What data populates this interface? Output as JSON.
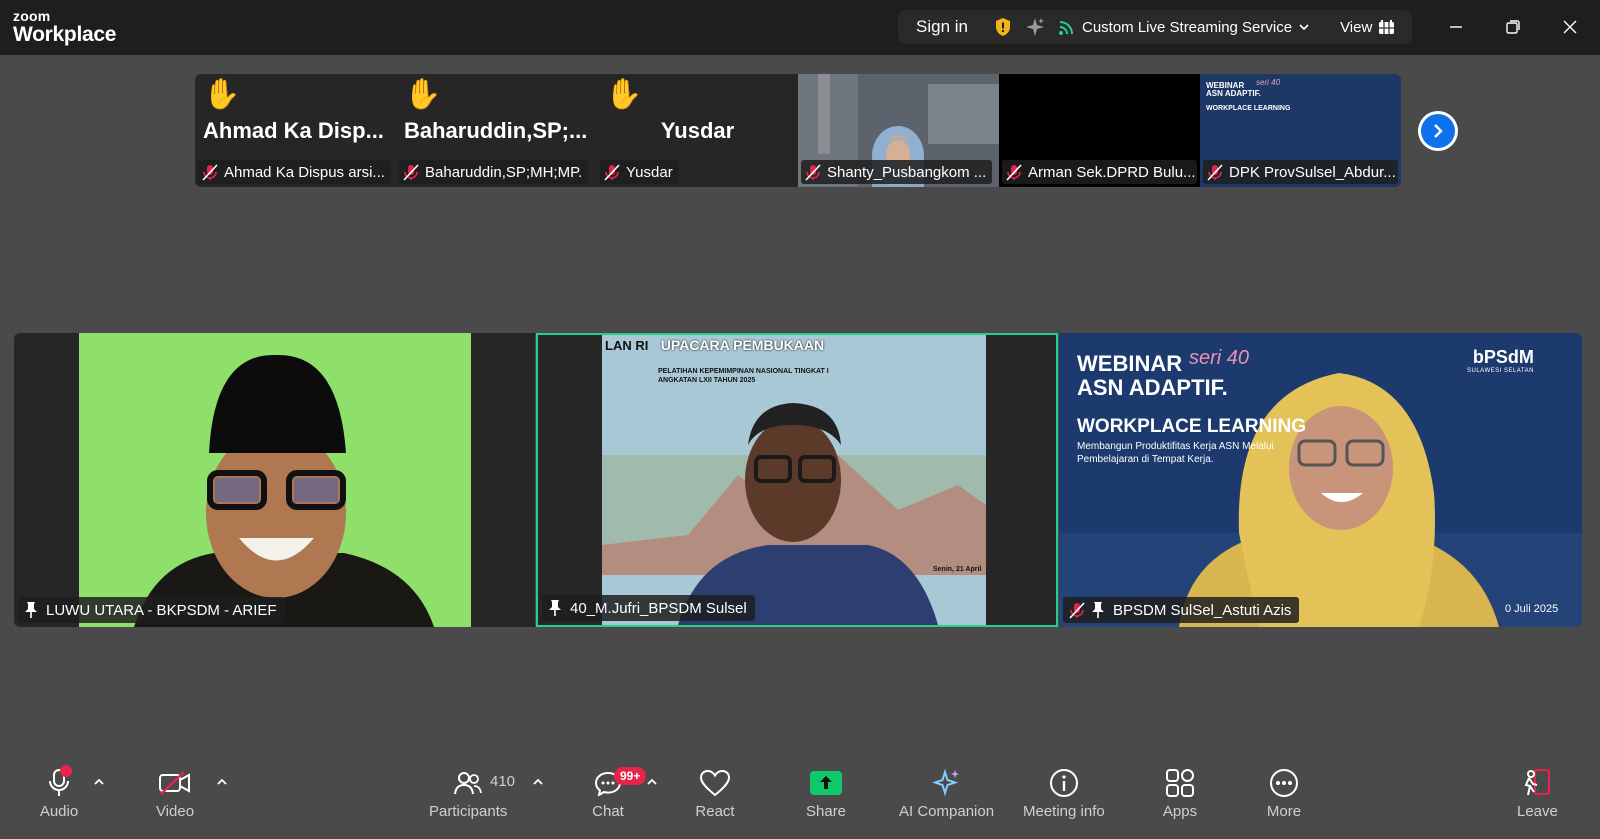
{
  "app": {
    "brand_line1": "zoom",
    "brand_line2": "Workplace"
  },
  "topbar": {
    "sign_in": "Sign in",
    "streaming": "Custom Live Streaming Service",
    "view": "View"
  },
  "strip": {
    "thumbs": [
      {
        "big": "Ahmad Ka Disp...",
        "label": "Ahmad Ka Dispus arsi...",
        "hand": "✋"
      },
      {
        "big": "Baharuddin,SP;...",
        "label": "Baharuddin,SP;MH;MP.",
        "hand": "✋"
      },
      {
        "big": "Yusdar",
        "label": "Yusdar",
        "hand": "✋"
      },
      {
        "label": "Shanty_Pusbangkom ..."
      },
      {
        "label": "Arman Sek.DPRD Bulu..."
      },
      {
        "label": "DPK ProvSulsel_Abdur...",
        "slide": {
          "t1": "WEBINAR",
          "t2": "ASN ADAPTIF.",
          "t3": "WORKPLACE LEARNING",
          "seri": "seri 40"
        }
      }
    ]
  },
  "gallery": {
    "tiles": [
      {
        "name": "LUWU UTARA - BKPSDM - ARIEF"
      },
      {
        "name": "40_M.Jufri_BPSDM Sulsel",
        "backdrop": {
          "org": "LAN RI",
          "title": "UPACARA PEMBUKAAN",
          "sub1": "PELATIHAN KEPEMIMPINAN NASIONAL TINGKAT I",
          "sub2": "ANGKATAN LXII TAHUN 2025",
          "date": "Senin, 21 April"
        }
      },
      {
        "name": "BPSDM SulSel_Astuti Azis",
        "backdrop": {
          "t1": "WEBINAR",
          "seri": "seri 40",
          "t2": "ASN ADAPTIF.",
          "t3": "WORKPLACE LEARNING",
          "sub1": "Membangun Produktifitas Kerja ASN Melalui",
          "sub2": "Pembelajaran di Tempat Kerja.",
          "logo": "bPSdM",
          "logo_sub": "SULAWESI SELATAN",
          "date": "0 Juli 2025"
        }
      }
    ]
  },
  "toolbar": {
    "audio": "Audio",
    "video": "Video",
    "participants": "Participants",
    "participants_count": "410",
    "chat": "Chat",
    "chat_badge": "99+",
    "react": "React",
    "share": "Share",
    "ai": "AI Companion",
    "meeting_info": "Meeting info",
    "apps": "Apps",
    "more": "More",
    "leave": "Leave"
  },
  "colors": {
    "active_speaker": "#23d18b",
    "accent_blue": "#0e72ed",
    "share_green": "#0fc86b",
    "alert_red": "#e8234a",
    "raise_hand": "#f2b21a"
  }
}
